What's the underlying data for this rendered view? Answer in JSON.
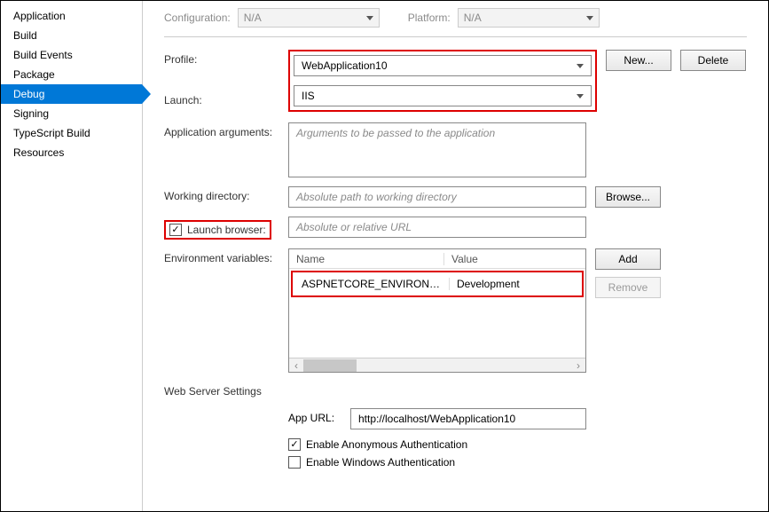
{
  "sidebar": {
    "items": [
      {
        "label": "Application"
      },
      {
        "label": "Build"
      },
      {
        "label": "Build Events"
      },
      {
        "label": "Package"
      },
      {
        "label": "Debug",
        "active": true
      },
      {
        "label": "Signing"
      },
      {
        "label": "TypeScript Build"
      },
      {
        "label": "Resources"
      }
    ]
  },
  "toprow": {
    "configuration_label": "Configuration:",
    "configuration_value": "N/A",
    "platform_label": "Platform:",
    "platform_value": "N/A"
  },
  "labels": {
    "profile": "Profile:",
    "launch": "Launch:",
    "app_args": "Application arguments:",
    "working_dir": "Working directory:",
    "launch_browser": "Launch browser:",
    "env_vars": "Environment variables:",
    "web_server": "Web Server Settings",
    "app_url": "App URL:"
  },
  "values": {
    "profile": "WebApplication10",
    "launch": "IIS",
    "app_args_placeholder": "Arguments to be passed to the application",
    "working_dir_placeholder": "Absolute path to working directory",
    "launch_browser_placeholder": "Absolute or relative URL",
    "app_url": "http://localhost/WebApplication10"
  },
  "buttons": {
    "new": "New...",
    "delete": "Delete",
    "browse": "Browse...",
    "add": "Add",
    "remove": "Remove"
  },
  "env": {
    "col_name": "Name",
    "col_value": "Value",
    "row_name": "ASPNETCORE_ENVIRONMENT",
    "row_value": "Development"
  },
  "checks": {
    "anon": "Enable Anonymous Authentication",
    "windows": "Enable Windows Authentication"
  }
}
